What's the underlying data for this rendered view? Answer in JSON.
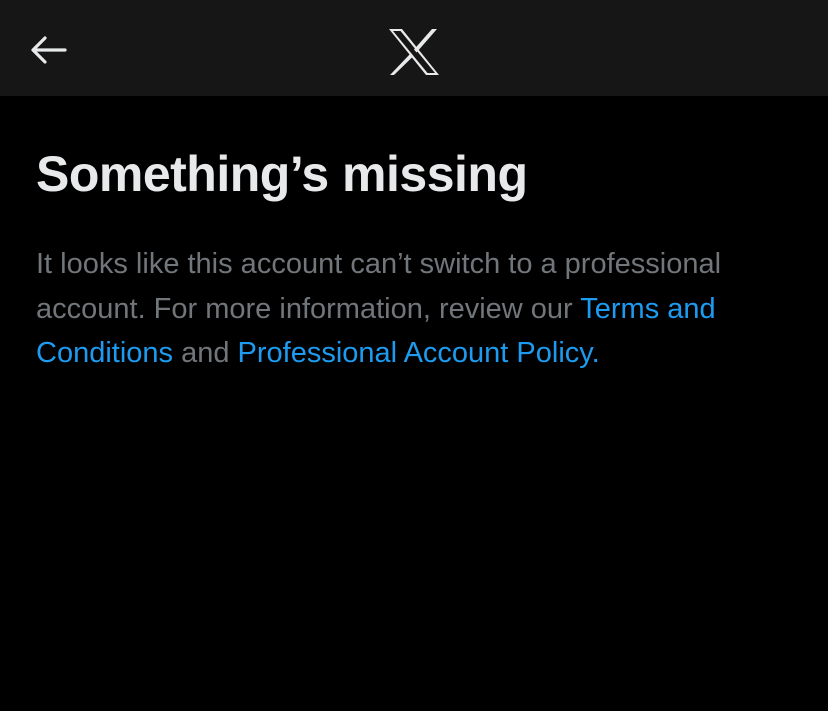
{
  "header": {
    "back_icon": "arrow-left-icon",
    "logo_icon": "x-logo-icon"
  },
  "main": {
    "title": "Something’s missing",
    "message": {
      "text_before": "It looks like this account can’t switch to a professional account. For more information, review our ",
      "terms_link": "Terms and Conditions",
      "text_between": " and ",
      "policy_link": "Professional Account Policy."
    }
  },
  "colors": {
    "background": "#000000",
    "header_background": "#161616",
    "title": "#e7e9ea",
    "body_text": "#71767b",
    "link": "#1d9bf0"
  }
}
